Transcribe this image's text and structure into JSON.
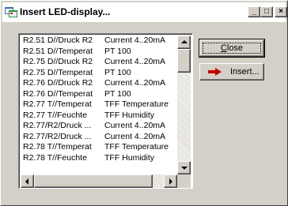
{
  "window": {
    "title": "Insert LED-display...",
    "icon": "app-window-icon",
    "caption_buttons": {
      "minimize": "_",
      "maximize": "□",
      "close": "×"
    }
  },
  "list": {
    "rows": [
      {
        "name": "R2.51 D//Druck R2",
        "type": "Current 4..20mA"
      },
      {
        "name": "R2.51 D//Temperat",
        "type": "PT 100"
      },
      {
        "name": "R2.75 D//Druck R2",
        "type": "Current 4..20mA"
      },
      {
        "name": "R2.75 D//Temperat",
        "type": "PT 100"
      },
      {
        "name": "R2.76 D//Druck R2",
        "type": "Current 4..20mA"
      },
      {
        "name": "R2.76 D//Temperat",
        "type": "PT 100"
      },
      {
        "name": "R2.77 T//Temperat",
        "type": "TFF Temperature"
      },
      {
        "name": "R2.77 T//Feuchte",
        "type": "TFF Humidity"
      },
      {
        "name": "R2.77/R2/Druck ...",
        "type": "Current 4..20mA"
      },
      {
        "name": "R2.77/R2/Druck ...",
        "type": "Current 4..20mA"
      },
      {
        "name": "R2.78 T//Temperat",
        "type": "TFF Temperature"
      },
      {
        "name": "R2.78 T//Feuchte",
        "type": "TFF Humidity"
      }
    ]
  },
  "buttons": {
    "close_label_first": "C",
    "close_label_rest": "lose",
    "insert_label": "Insert...",
    "insert_icon": "red-arrow-icon"
  },
  "colors": {
    "face": "#d4d0c8",
    "arrow_red": "#c00000"
  }
}
